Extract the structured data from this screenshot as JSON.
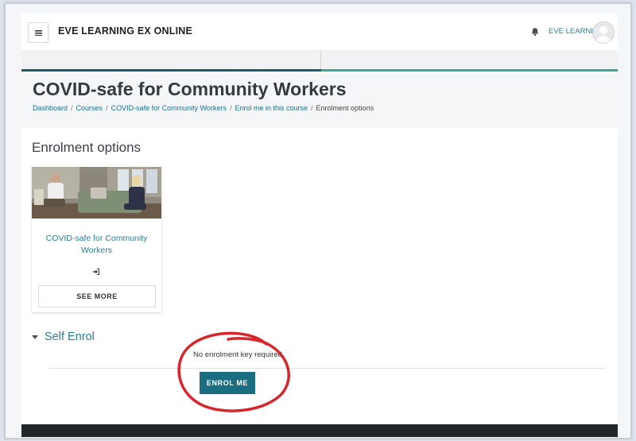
{
  "header": {
    "site_name": "EVE LEARNING EX ONLINE",
    "user_name": "EVE LEARNING",
    "icons": {
      "menu": "hamburger-icon",
      "notifications": "bell-icon",
      "avatar": "user-avatar-icon"
    }
  },
  "page": {
    "title": "COVID-safe for Community Workers",
    "breadcrumb": [
      {
        "label": "Dashboard"
      },
      {
        "label": "Courses"
      },
      {
        "label": "COVID-safe for Community Workers"
      },
      {
        "label": "Enrol me in this course"
      },
      {
        "label": "Enrolment options"
      }
    ]
  },
  "enrolment": {
    "section_title": "Enrolment options",
    "course_card": {
      "name": "COVID-safe for Community Workers",
      "see_more_label": "SEE MORE",
      "enrol_icon": "sign-in-icon"
    },
    "self_enrol": {
      "title": "Self Enrol",
      "message": "No enrolment key required.",
      "button_label": "ENROL ME"
    }
  },
  "colors": {
    "accent": "#1b6e82",
    "link": "#2a7e99",
    "highlight_circle": "#d6262b"
  }
}
